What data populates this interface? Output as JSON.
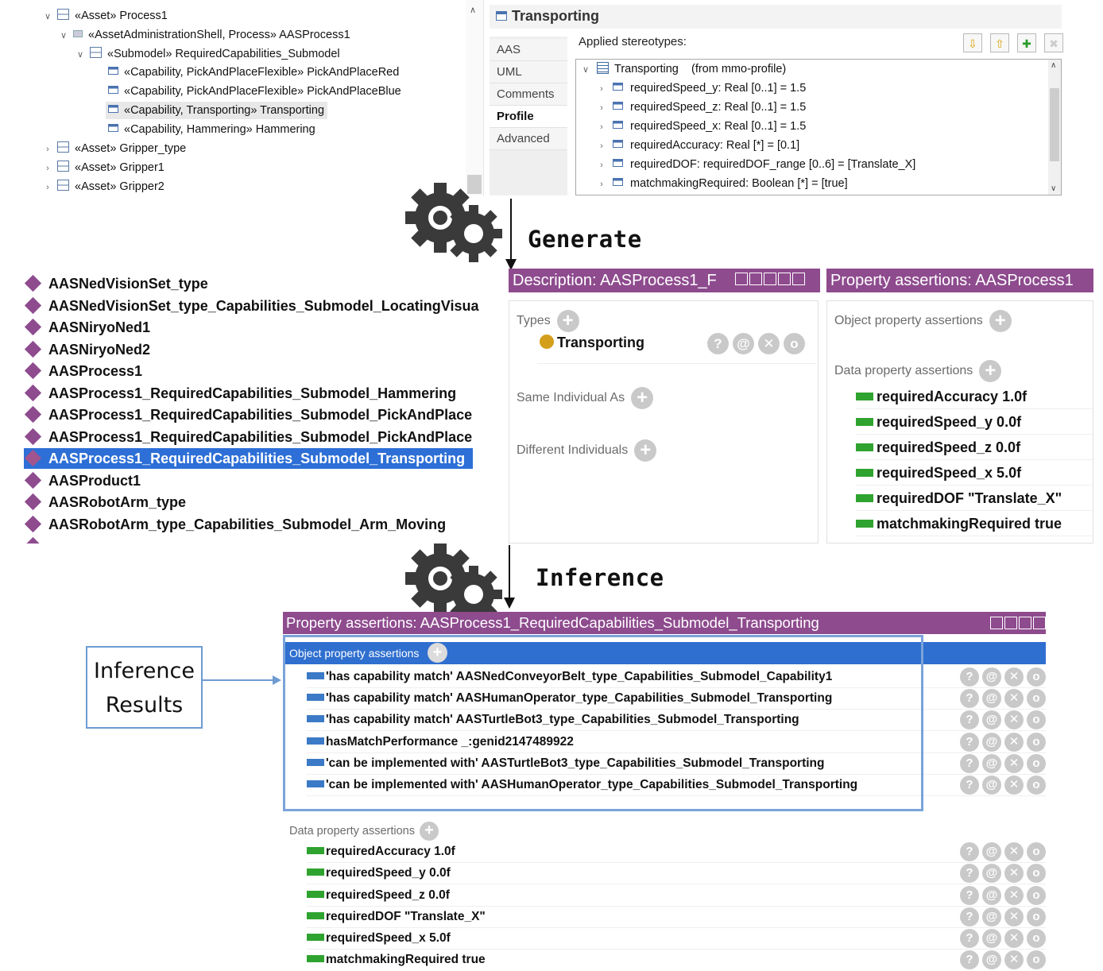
{
  "top_tree": {
    "items": [
      {
        "level": 0,
        "expand": "down",
        "icon": "asset",
        "label": "«Asset» Process1"
      },
      {
        "level": 1,
        "expand": "down",
        "icon": "aas",
        "label": "«AssetAdministrationShell, Process» AASProcess1"
      },
      {
        "level": 2,
        "expand": "down",
        "icon": "asset",
        "label": "«Submodel» RequiredCapabilities_Submodel"
      },
      {
        "level": 3,
        "expand": "",
        "icon": "cap",
        "label": "«Capability, PickAndPlaceFlexible» PickAndPlaceRed"
      },
      {
        "level": 3,
        "expand": "",
        "icon": "cap",
        "label": "«Capability, PickAndPlaceFlexible» PickAndPlaceBlue"
      },
      {
        "level": 3,
        "expand": "",
        "icon": "cap",
        "label": "«Capability, Transporting» Transporting",
        "selected": true
      },
      {
        "level": 3,
        "expand": "",
        "icon": "cap",
        "label": "«Capability, Hammering» Hammering"
      },
      {
        "level": 0,
        "expand": "right",
        "icon": "asset",
        "label": "«Asset» Gripper_type"
      },
      {
        "level": 0,
        "expand": "right",
        "icon": "asset",
        "label": "«Asset» Gripper1"
      },
      {
        "level": 0,
        "expand": "right",
        "icon": "asset",
        "label": "«Asset» Gripper2"
      }
    ]
  },
  "properties_panel": {
    "title": "Transporting",
    "tabs": [
      "AAS",
      "UML",
      "Comments",
      "Profile",
      "Advanced"
    ],
    "active_tab": "Profile",
    "applied_label": "Applied stereotypes:",
    "stereotype_root": "Transporting",
    "stereotype_from": "(from mmo-profile)",
    "stereotype_rows": [
      "requiredSpeed_y: Real [0..1] = 1.5",
      "requiredSpeed_z: Real [0..1] = 1.5",
      "requiredSpeed_x: Real [0..1] = 1.5",
      "requiredAccuracy: Real [*] = [0.1]",
      "requiredDOF: requiredDOF_range [0..6] = [Translate_X]",
      "matchmakingRequired: Boolean [*] = [true]"
    ]
  },
  "steps": {
    "generate": "Generate",
    "inference": "Inference"
  },
  "individuals": [
    "AASNedVisionSet_type",
    "AASNedVisionSet_type_Capabilities_Submodel_LocatingVisua",
    "AASNiryoNed1",
    "AASNiryoNed2",
    "AASProcess1",
    "AASProcess1_RequiredCapabilities_Submodel_Hammering",
    "AASProcess1_RequiredCapabilities_Submodel_PickAndPlace",
    "AASProcess1_RequiredCapabilities_Submodel_PickAndPlace",
    "AASProcess1_RequiredCapabilities_Submodel_Transporting",
    "AASProduct1",
    "AASRobotArm_type",
    "AASRobotArm_type_Capabilities_Submodel_Arm_Moving"
  ],
  "selected_individual": 8,
  "description_panel": {
    "title": "Description: AASProcess1_F",
    "types_label": "Types",
    "type_value": "Transporting",
    "same_label": "Same Individual As",
    "different_label": "Different Individuals"
  },
  "property_panel_mid": {
    "title": "Property assertions: AASProcess1",
    "object_label": "Object property assertions",
    "data_label": "Data property assertions",
    "data": [
      "requiredAccuracy  1.0f",
      "requiredSpeed_y  0.0f",
      "requiredSpeed_z  0.0f",
      "requiredSpeed_x  5.0f",
      "requiredDOF  \"Translate_X\"",
      "matchmakingRequired  true"
    ]
  },
  "result_panel": {
    "title": "Property assertions: AASProcess1_RequiredCapabilities_Submodel_Transporting",
    "object_label": "Object property assertions",
    "object_rows": [
      "'has capability match'  AASNedConveyorBelt_type_Capabilities_Submodel_Capability1",
      "'has capability match'  AASHumanOperator_type_Capabilities_Submodel_Transporting",
      "'has capability match'  AASTurtleBot3_type_Capabilities_Submodel_Transporting",
      "hasMatchPerformance  _:genid2147489922",
      "'can be implemented with'  AASTurtleBot3_type_Capabilities_Submodel_Transporting",
      "'can be implemented with'  AASHumanOperator_type_Capabilities_Submodel_Transporting"
    ],
    "data_label": "Data property assertions",
    "data_rows": [
      "requiredAccuracy  1.0f",
      "requiredSpeed_y  0.0f",
      "requiredSpeed_z  0.0f",
      "requiredDOF  \"Translate_X\"",
      "requiredSpeed_x  5.0f",
      "matchmakingRequired  true"
    ]
  },
  "annotation": {
    "line1": "Inference",
    "line2": "Results"
  },
  "colors": {
    "protege_purple": "#8e4b8e",
    "selection_blue": "#2d6fd6",
    "object_prop": "#3b7ac6",
    "data_prop": "#2fa32f",
    "type_dot": "#d4a01c",
    "highlight_border": "#7aa3d9"
  }
}
